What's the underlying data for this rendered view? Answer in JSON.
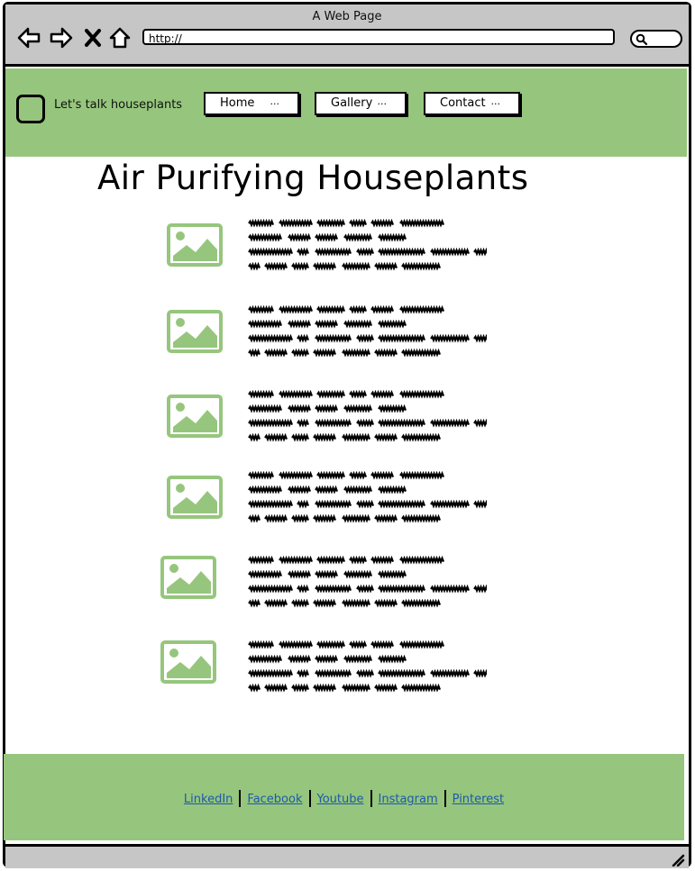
{
  "browser": {
    "title": "A Web Page",
    "url": "http://",
    "icons": [
      "back-icon",
      "forward-icon",
      "close-icon",
      "home-icon",
      "search-icon"
    ]
  },
  "header": {
    "site_name": "Let's talk houseplants",
    "nav": [
      {
        "label": "Home",
        "dots": "..."
      },
      {
        "label": "Gallery",
        "dots": "..."
      },
      {
        "label": "Contact",
        "dots": "..."
      }
    ]
  },
  "main": {
    "title": "Air Purifying Houseplants",
    "items_count_note": "",
    "items": [
      {
        "image": "image-placeholder-icon",
        "text": "placeholder-scribble-text"
      },
      {
        "image": "image-placeholder-icon",
        "text": "placeholder-scribble-text"
      },
      {
        "image": "image-placeholder-icon",
        "text": "placeholder-scribble-text"
      },
      {
        "image": "image-placeholder-icon",
        "text": "placeholder-scribble-text"
      },
      {
        "image": "image-placeholder-icon",
        "text": "placeholder-scribble-text"
      },
      {
        "image": "image-placeholder-icon",
        "text": "placeholder-scribble-text"
      }
    ]
  },
  "footer": {
    "links": [
      "LinkedIn",
      "Facebook",
      "Youtube",
      "Instagram",
      "Pinterest"
    ]
  },
  "colors": {
    "accent_green": "#96c67d",
    "chrome_gray": "#c6c6c6",
    "link_blue": "#1c5aa8"
  }
}
